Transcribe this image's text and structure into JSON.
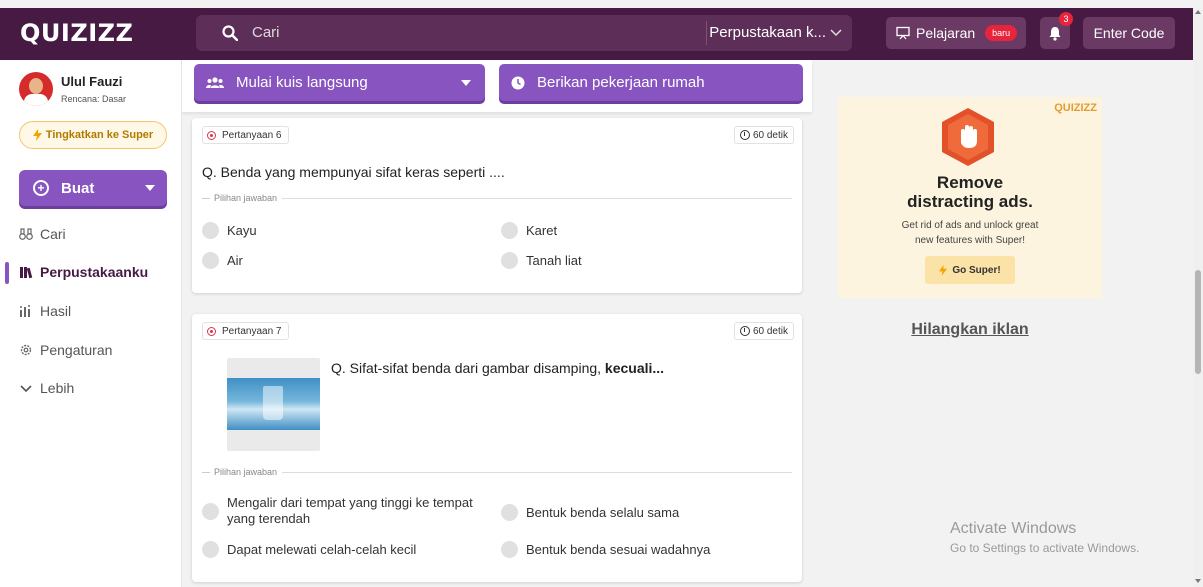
{
  "header": {
    "logo": "QUIZIZZ",
    "search_placeholder": "Cari",
    "search_scope": "Perpustakaan k...",
    "pelajaran_label": "Pelajaran",
    "pelajaran_badge": "baru",
    "notification_count": "3",
    "enter_code_label": "Enter Code"
  },
  "sidebar": {
    "user_name": "Ulul Fauzi",
    "user_plan": "Rencana: Dasar",
    "upgrade_label": "Tingkatkan ke Super",
    "create_label": "Buat",
    "nav": {
      "search": "Cari",
      "library": "Perpustakaanku",
      "results": "Hasil",
      "settings": "Pengaturan",
      "more": "Lebih"
    },
    "active_item": "Perpustakaanku"
  },
  "actions": {
    "live_quiz": "Mulai kuis langsung",
    "homework": "Berikan pekerjaan rumah"
  },
  "questions": [
    {
      "tag": "Pertanyaan 6",
      "time": "60 detik",
      "text": "Q. Benda yang mempunyai sifat keras seperti ....",
      "choices_label": "Pilihan jawaban",
      "choices": [
        "Kayu",
        "Karet",
        "Air",
        "Tanah liat"
      ]
    },
    {
      "tag": "Pertanyaan 7",
      "time": "60 detik",
      "text_prefix": "Q. Sifat-sifat benda dari gambar disamping, ",
      "text_bold": "kecuali...",
      "choices_label": "Pilihan jawaban",
      "choices": [
        "Mengalir dari tempat yang tinggi ke tempat yang terendah",
        "Bentuk benda selalu sama",
        "Dapat melewati celah-celah kecil",
        "Bentuk benda sesuai wadahnya"
      ]
    }
  ],
  "ad": {
    "brand": "QUIZIZZ",
    "title_line1": "Remove",
    "title_line2": "distracting ads.",
    "subtitle_line1": "Get  rid of ads and unlock great",
    "subtitle_line2": "new features with Super!",
    "button": "Go Super!",
    "remove_link": "Hilangkan iklan"
  },
  "watermark": {
    "line1": "Activate Windows",
    "line2": "Go to Settings to activate Windows."
  },
  "colors": {
    "topbar": "#461a42",
    "accent": "#8854c0",
    "badge": "#e8233c",
    "upgrade": "#f2c66d"
  }
}
